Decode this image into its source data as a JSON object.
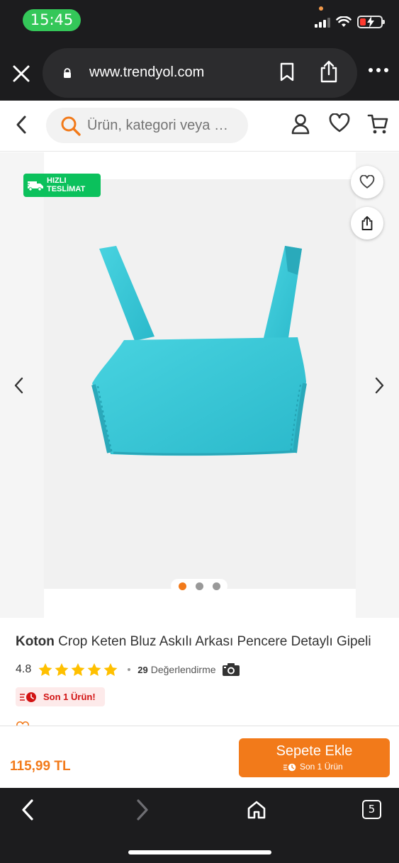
{
  "status_bar": {
    "time": "15:45"
  },
  "browser": {
    "url": "www.trendyol.com",
    "open_tabs": "5"
  },
  "header": {
    "search_placeholder": "Ürün, kategori veya …"
  },
  "gallery": {
    "badge_line1": "HIZLI",
    "badge_line2": "TESLİMAT",
    "image_count": 3,
    "active_index": 0
  },
  "product": {
    "brand": "Koton",
    "name": "Crop Keten Bluz Askılı Arkası Pencere Detaylı Gipeli",
    "rating": "4.8",
    "stars": 5,
    "review_count": "29",
    "review_label": "Değerlendirme",
    "stock_label": "Son 1 Ürün!"
  },
  "buy_bar": {
    "price": "115,99 TL",
    "add_to_cart": "Sepete Ekle",
    "add_to_cart_sub": "Son 1 Ürün"
  },
  "colors": {
    "brand_orange": "#f27a1a",
    "fast_delivery_green": "#0bc15c",
    "stock_red": "#d21313",
    "product_turquoise": "#3cc7d6"
  },
  "icons": [
    "close-icon",
    "lock-icon",
    "bookmark-icon",
    "share-icon",
    "more-icon",
    "back-icon",
    "search-icon",
    "user-icon",
    "heart-icon",
    "cart-icon",
    "truck-icon",
    "chevron-left-icon",
    "chevron-right-icon",
    "star-icon",
    "camera-icon",
    "clock-icon",
    "home-icon",
    "tabs-icon"
  ]
}
